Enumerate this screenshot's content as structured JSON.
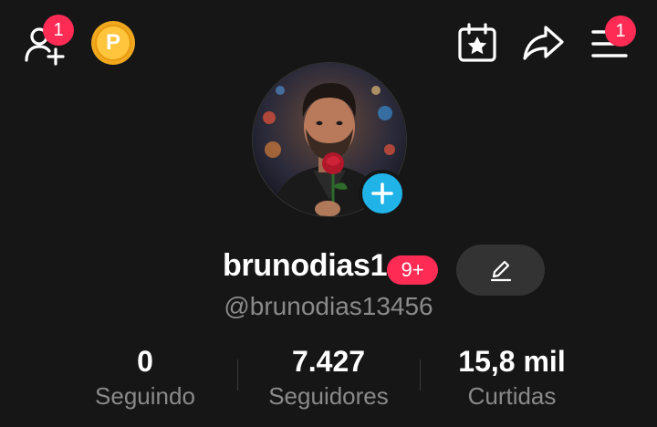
{
  "header": {
    "friends_badge": "1",
    "menu_badge": "1",
    "coin_label": "P"
  },
  "profile": {
    "username": "brunodias1",
    "notification_pill": "9+",
    "handle": "@brunodias13456"
  },
  "stats": [
    {
      "value": "0",
      "label": "Seguindo"
    },
    {
      "value": "7.427",
      "label": "Seguidores"
    },
    {
      "value": "15,8 mil",
      "label": "Curtidas"
    }
  ],
  "colors": {
    "background": "#161616",
    "badge_red": "#fe2c55",
    "plus_blue": "#1fb3e8",
    "coin_gold": "#f0a91e",
    "muted_text": "#8a8a8a"
  }
}
